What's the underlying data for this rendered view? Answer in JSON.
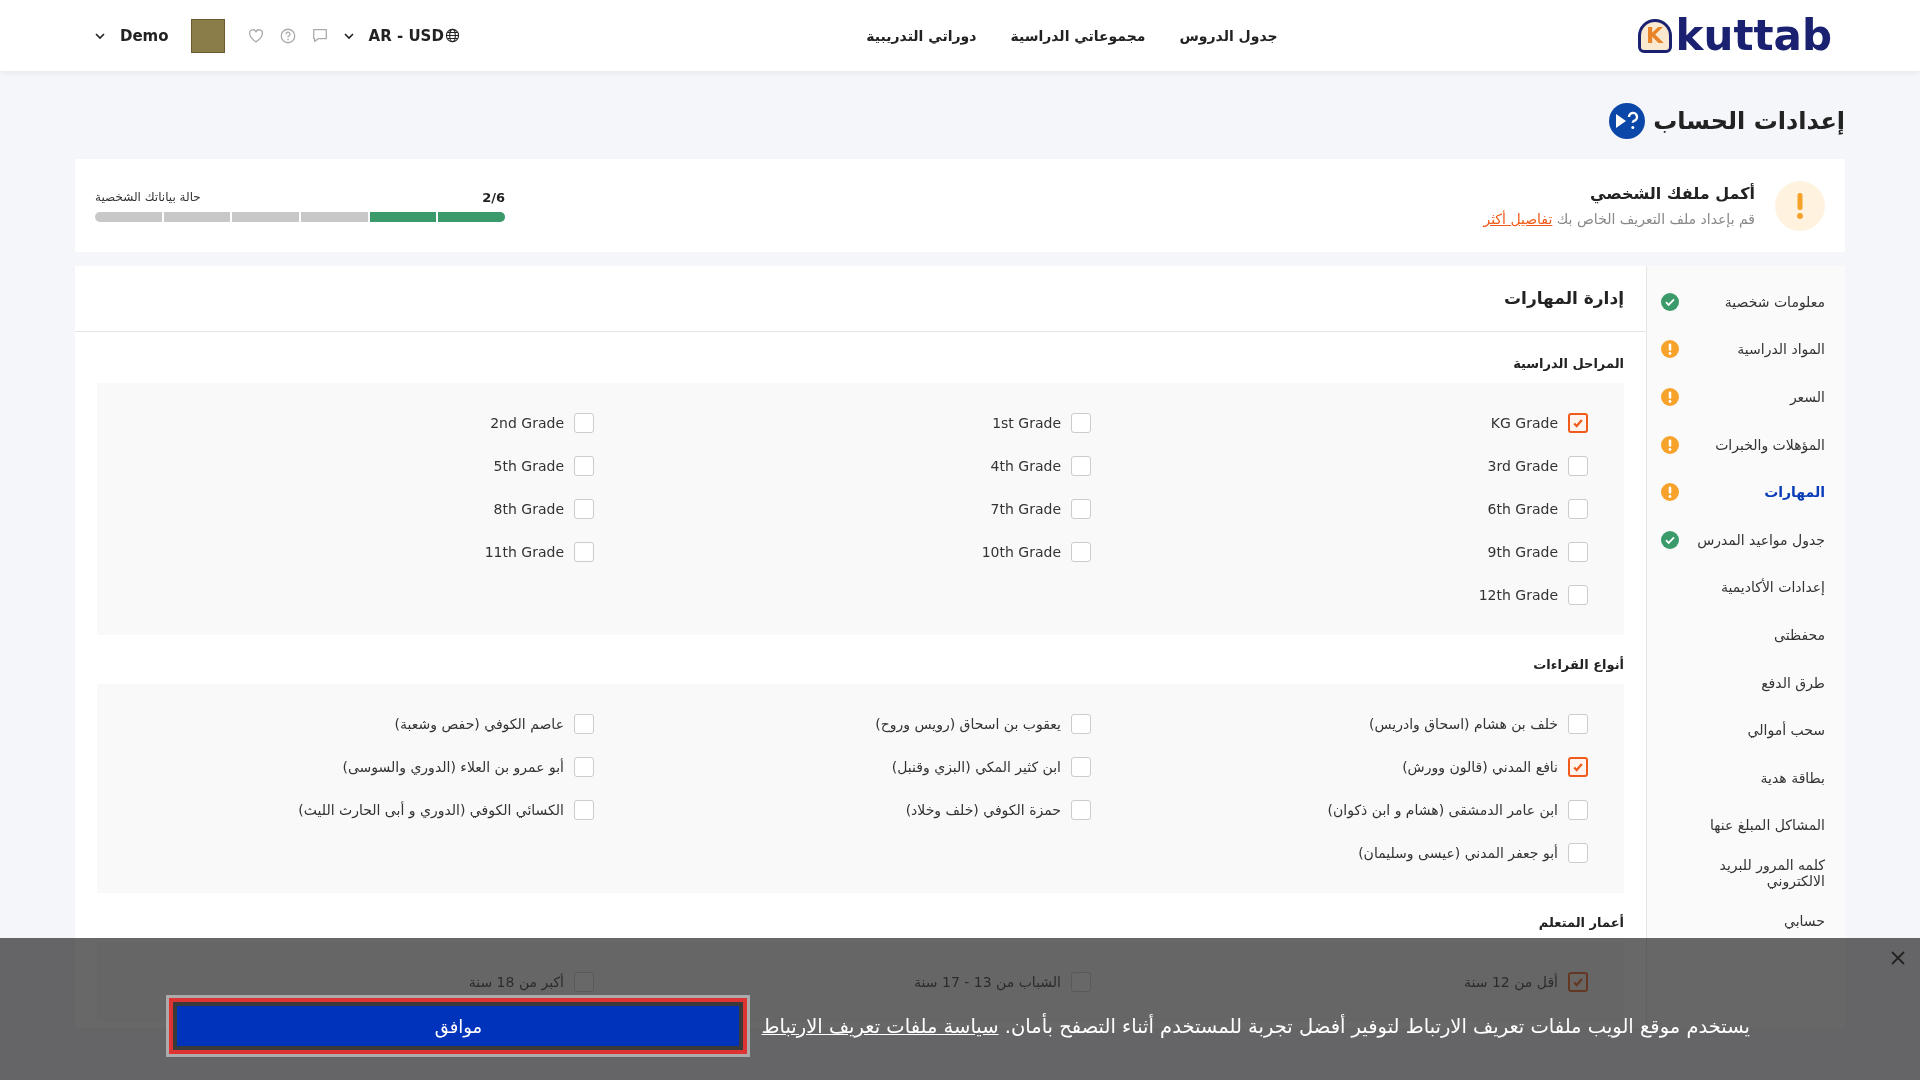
{
  "header": {
    "logo": {
      "mark": "K",
      "text": "kuttab"
    },
    "nav": [
      {
        "label": "جدول الدروس"
      },
      {
        "label": "مجموعاتي الدراسية"
      },
      {
        "label": "دوراتي التدريبية"
      }
    ],
    "locale": "AR - USD",
    "user": "Demo"
  },
  "page_title": "إعدادات الحساب",
  "profile_card": {
    "title": "أكمل ملفك الشخصي",
    "description": "قم بإعداد ملف التعريف الخاص بك",
    "link": "تفاصيل أكثر",
    "status_label": "حالة بياناتك الشخصية",
    "count": "2/6",
    "level": 0.3333
  },
  "sidebar": {
    "items": [
      {
        "label": "معلومات شخصية",
        "kind": "done",
        "selected": false
      },
      {
        "label": "المواد الدراسية",
        "kind": "pending",
        "selected": false
      },
      {
        "label": "السعر",
        "kind": "pending",
        "selected": false
      },
      {
        "label": "المؤهلات والخبرات",
        "kind": "pending",
        "selected": false
      },
      {
        "label": "المهارات",
        "kind": "pending",
        "selected": true
      },
      {
        "label": "جدول مواعيد المدرس",
        "kind": "done",
        "selected": false
      },
      {
        "label": "إعدادات الأكاديمية",
        "kind": "plain",
        "selected": false
      },
      {
        "label": "محفظتى",
        "kind": "plain",
        "selected": false
      },
      {
        "label": "طرق الدفع",
        "kind": "plain",
        "selected": false
      },
      {
        "label": "سحب أموالي",
        "kind": "plain",
        "selected": false
      },
      {
        "label": "بطاقة هدية",
        "kind": "plain",
        "selected": false
      },
      {
        "label": "المشاكل المبلغ عنها",
        "kind": "plain",
        "selected": false
      },
      {
        "label": "كلمه المرور للبريد الالكتروني",
        "kind": "plain",
        "selected": false
      },
      {
        "label": "حسابي",
        "kind": "plain",
        "selected": false
      }
    ]
  },
  "skills": {
    "title": "إدارة المهارات",
    "sections": [
      {
        "heading": "المراحل الدراسية",
        "options": [
          {
            "label": "KG Grade",
            "checked": true
          },
          {
            "label": "1st Grade",
            "checked": false
          },
          {
            "label": "2nd Grade",
            "checked": false
          },
          {
            "label": "3rd Grade",
            "checked": false
          },
          {
            "label": "4th Grade",
            "checked": false
          },
          {
            "label": "5th Grade",
            "checked": false
          },
          {
            "label": "6th Grade",
            "checked": false
          },
          {
            "label": "7th Grade",
            "checked": false
          },
          {
            "label": "8th Grade",
            "checked": false
          },
          {
            "label": "9th Grade",
            "checked": false
          },
          {
            "label": "10th Grade",
            "checked": false
          },
          {
            "label": "11th Grade",
            "checked": false
          },
          {
            "label": "12th Grade",
            "checked": false
          }
        ]
      },
      {
        "heading": "أنواع القراءات",
        "options": [
          {
            "label": "خلف بن هشام (اسحاق وادريس)",
            "checked": false
          },
          {
            "label": "يعقوب بن اسحاق (رويس وروح)",
            "checked": false
          },
          {
            "label": "عاصم الكوفي (حفص وشعبة)",
            "checked": false
          },
          {
            "label": "نافع المدني (قالون وورش)",
            "checked": true
          },
          {
            "label": "ابن كثير المكي (البزي وقنبل)",
            "checked": false
          },
          {
            "label": "أبو عمرو بن العلاء (الدوري والسوسى)",
            "checked": false
          },
          {
            "label": "ابن عامر الدمشقى (هشام و ابن ذكوان)",
            "checked": false
          },
          {
            "label": "حمزة الكوفي (خلف وخلاد)",
            "checked": false
          },
          {
            "label": "الكسائي الكوفي (الدوري و أبى الحارث الليث)",
            "checked": false
          },
          {
            "label": "أبو جعفر المدني (عيسى وسليمان)",
            "checked": false
          }
        ]
      },
      {
        "heading": "أعمار المتعلم",
        "options": [
          {
            "label": "أقل من 12 سنة",
            "checked": true
          },
          {
            "label": "الشباب من 13 - 17 سنة",
            "checked": false
          },
          {
            "label": "أكبر من 18 سنة",
            "checked": false
          }
        ]
      }
    ]
  },
  "cookie_banner": {
    "message": "يستخدم موقع الويب ملفات تعريف الارتباط لتوفير أفضل تجربة للمستخدم أثناء التصفح بأمان.",
    "link": "سياسة ملفات تعريف الارتباط",
    "button": "موافق"
  }
}
